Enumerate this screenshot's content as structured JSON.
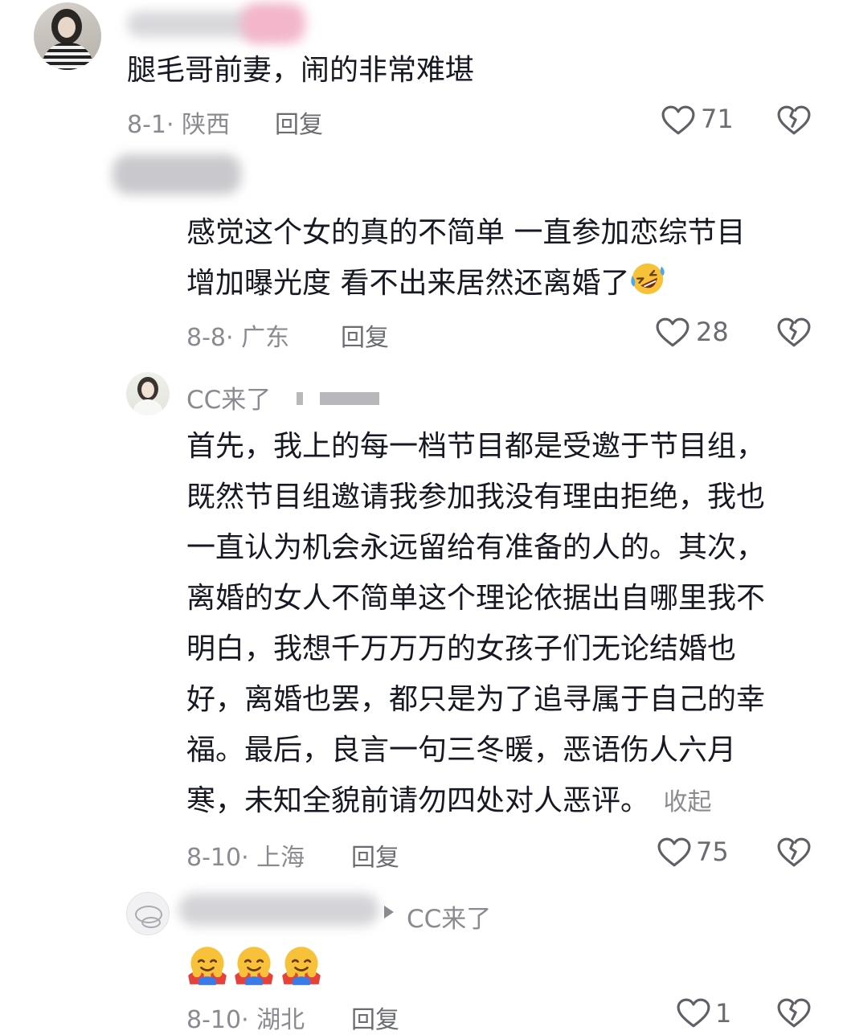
{
  "comments": [
    {
      "text_lines": [
        "腿毛哥前妻，闹的非常难堪"
      ],
      "date": "8-1",
      "region": "陕西",
      "reply_label": "回复",
      "likes": "71"
    },
    {
      "text_lines": [
        "感觉这个女的真的不简单 一直参加恋综节目",
        "增加曝光度 看不出来居然还离婚了"
      ],
      "date": "8-8",
      "region": "广东",
      "reply_label": "回复",
      "likes": "28"
    },
    {
      "author": "CC来了",
      "text_lines": [
        "首先，我上的每一档节目都是受邀于节目组，",
        "既然节目组邀请我参加我没有理由拒绝，我也",
        "一直认为机会永远留给有准备的人的。其次，",
        "离婚的女人不简单这个理论依据出自哪里我不",
        "明白，我想千万万万的女孩子们无论结婚也",
        "好，离婚也罢，都只是为了追寻属于自己的幸",
        "福。最后，良言一句三冬暖，恶语伤人六月",
        "寒，未知全貌前请勿四处对人恶评。"
      ],
      "collapse_label": "收起",
      "date": "8-10",
      "region": "上海",
      "reply_label": "回复",
      "likes": "75"
    },
    {
      "reply_to": "CC来了",
      "date": "8-10",
      "region": "湖北",
      "reply_label": "回复",
      "likes": "1"
    }
  ],
  "icons": {
    "like": "heart-outline-icon",
    "dislike": "broken-heart-icon",
    "reply_arrow": "triangle-right-icon",
    "emoji_laugh": "rolling-laughing-emoji",
    "emoji_hug": "hugging-face-emoji"
  }
}
